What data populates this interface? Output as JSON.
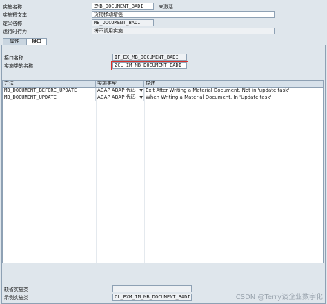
{
  "header": {
    "impl_name_label": "实施名称",
    "impl_name_value": "ZMB_DOCUMENT_BADI",
    "status": "未激活",
    "short_text_label": "实施短文本",
    "short_text_value": "货物移动增强",
    "def_name_label": "定义名称",
    "def_name_value": "MB_DOCUMENT_BADI",
    "runtime_label": "运行时行为",
    "runtime_value": "将不调用实施"
  },
  "tabs": [
    {
      "label": "属性"
    },
    {
      "label": "接口"
    }
  ],
  "interface": {
    "name_label": "接口名称",
    "name_value": "IF_EX_MB_DOCUMENT_BADI",
    "class_label": "实施类的名称",
    "class_value": "ZCL_IM_MB_DOCUMENT_BADI"
  },
  "table": {
    "columns": [
      "方法",
      "实施类型",
      "描述"
    ],
    "rows": [
      {
        "method": "MB_DOCUMENT_BEFORE_UPDATE",
        "type": "ABAP ABAP 代码",
        "desc": "Exit After Writing a Material Document. Not in 'update task'"
      },
      {
        "method": "MB_DOCUMENT_UPDATE",
        "type": "ABAP ABAP 代码",
        "desc": "When Writing a Material Document. In 'Update task'"
      }
    ]
  },
  "footer": {
    "default_label": "缺省实施类",
    "default_value": "",
    "sample_label": "示例实施类",
    "sample_value": "CL_EXM_IM_MB_DOCUMENT_BADI"
  },
  "watermark": "CSDN @Terry谈企业数字化",
  "colors": {
    "highlight_box": "#d9312b"
  }
}
